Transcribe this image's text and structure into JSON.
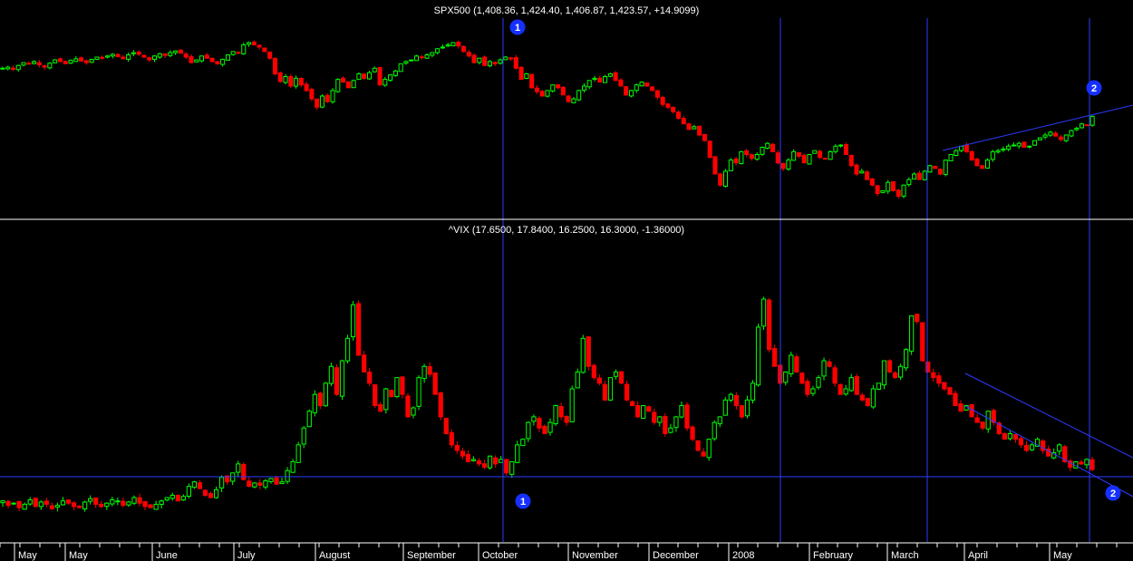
{
  "chart_data": [
    {
      "type": "candlestick",
      "title": "SPX500 (1,408.36, 1,424.40, 1,406.87, 1,423.57, +14.9099)",
      "ylim": [
        1250,
        1600
      ],
      "colors": {
        "up": "#00ff00",
        "down": "#ff0000"
      },
      "closes": [
        1510,
        1512,
        1508,
        1515,
        1520,
        1518,
        1522,
        1516,
        1512,
        1519,
        1525,
        1522,
        1518,
        1524,
        1527,
        1523,
        1520,
        1526,
        1530,
        1528,
        1532,
        1535,
        1531,
        1527,
        1534,
        1538,
        1535,
        1530,
        1525,
        1532,
        1536,
        1533,
        1538,
        1541,
        1537,
        1530,
        1520,
        1525,
        1532,
        1528,
        1522,
        1518,
        1526,
        1534,
        1540,
        1538,
        1552,
        1556,
        1552,
        1548,
        1540,
        1528,
        1500,
        1486,
        1495,
        1478,
        1492,
        1480,
        1470,
        1455,
        1440,
        1460,
        1450,
        1470,
        1490,
        1485,
        1475,
        1488,
        1500,
        1492,
        1502,
        1510,
        1480,
        1490,
        1498,
        1505,
        1518,
        1522,
        1525,
        1532,
        1530,
        1534,
        1538,
        1545,
        1548,
        1552,
        1556,
        1550,
        1540,
        1532,
        1520,
        1528,
        1515,
        1522,
        1518,
        1525,
        1530,
        1528,
        1510,
        1490,
        1500,
        1475,
        1468,
        1460,
        1470,
        1480,
        1475,
        1462,
        1450,
        1455,
        1470,
        1478,
        1488,
        1492,
        1485,
        1495,
        1500,
        1488,
        1478,
        1462,
        1470,
        1480,
        1485,
        1478,
        1470,
        1458,
        1445,
        1440,
        1432,
        1420,
        1410,
        1400,
        1405,
        1390,
        1380,
        1350,
        1320,
        1300,
        1325,
        1345,
        1340,
        1360,
        1355,
        1348,
        1355,
        1368,
        1375,
        1360,
        1340,
        1330,
        1345,
        1360,
        1352,
        1340,
        1355,
        1362,
        1350,
        1348,
        1360,
        1370,
        1372,
        1355,
        1335,
        1320,
        1325,
        1310,
        1300,
        1285,
        1290,
        1305,
        1290,
        1280,
        1300,
        1310,
        1320,
        1310,
        1325,
        1335,
        1330,
        1320,
        1345,
        1355,
        1362,
        1370,
        1360,
        1345,
        1335,
        1330,
        1345,
        1360,
        1362,
        1365,
        1370,
        1372,
        1375,
        1368,
        1370,
        1380,
        1385,
        1390,
        1395,
        1388,
        1382,
        1390,
        1398,
        1402,
        1410,
        1408,
        1423.57
      ]
    },
    {
      "type": "candlestick",
      "title": "^VIX (17.6500, 17.8400, 16.2500, 16.3000, -1.36000)",
      "ylim": [
        10,
        37
      ],
      "colors": {
        "up": "#00ff00",
        "down": "#ff0000"
      },
      "closes": [
        13.5,
        13.1,
        13.3,
        12.9,
        13.2,
        13.6,
        13.0,
        13.4,
        13.2,
        12.8,
        13.1,
        13.5,
        13.3,
        13.0,
        12.9,
        13.4,
        13.7,
        13.2,
        13.0,
        13.3,
        13.6,
        13.5,
        13.1,
        13.4,
        13.8,
        13.3,
        13.0,
        12.9,
        13.2,
        13.5,
        13.8,
        14.0,
        13.5,
        13.9,
        14.8,
        15.2,
        14.6,
        14.0,
        13.8,
        14.5,
        15.6,
        15.2,
        16.0,
        16.8,
        15.4,
        14.8,
        15.1,
        14.9,
        15.3,
        15.5,
        15.0,
        15.2,
        16.2,
        17.0,
        18.5,
        20.0,
        21.5,
        23.0,
        22.0,
        24.0,
        25.5,
        23.0,
        26.0,
        28.0,
        31.0,
        26.5,
        25.0,
        24.0,
        22.0,
        21.5,
        23.5,
        22.8,
        24.5,
        23.0,
        21.0,
        21.8,
        24.5,
        25.5,
        24.8,
        23.0,
        21.0,
        19.5,
        18.5,
        18.0,
        17.5,
        17.0,
        17.2,
        16.8,
        16.5,
        17.5,
        16.8,
        17.2,
        16.0,
        17.0,
        18.5,
        19.0,
        20.5,
        21.0,
        20.0,
        19.5,
        20.5,
        22.0,
        21.0,
        20.5,
        23.5,
        25.0,
        28.0,
        25.5,
        24.5,
        24.0,
        22.5,
        24.5,
        25.0,
        24.0,
        22.5,
        22.0,
        21.0,
        22.0,
        21.5,
        20.5,
        21.0,
        19.5,
        20.0,
        21.0,
        22.0,
        20.0,
        19.0,
        18.0,
        17.5,
        19.0,
        20.5,
        21.0,
        22.5,
        23.0,
        22.0,
        21.0,
        22.5,
        24.0,
        29.0,
        31.5,
        27.0,
        25.5,
        24.0,
        25.0,
        26.5,
        25.0,
        24.0,
        23.0,
        23.5,
        24.5,
        26.0,
        25.5,
        24.0,
        23.0,
        23.5,
        24.5,
        23.0,
        22.5,
        22.0,
        23.5,
        24.0,
        26.0,
        25.0,
        24.5,
        25.5,
        27.0,
        30.0,
        29.5,
        26.0,
        25.0,
        24.5,
        24.0,
        23.5,
        23.0,
        22.0,
        21.5,
        22.0,
        21.0,
        20.5,
        20.0,
        21.5,
        20.5,
        19.5,
        19.0,
        19.5,
        19.0,
        18.5,
        18.0,
        18.5,
        19.0,
        18.0,
        17.5,
        17.8,
        18.5,
        17.0,
        16.5,
        17.0,
        16.8,
        17.2,
        16.3
      ]
    }
  ],
  "x_axis_labels": [
    "May",
    "May",
    "June",
    "July",
    "August",
    "September",
    "October",
    "November",
    "December",
    "2008",
    "February",
    "March",
    "April",
    "May"
  ],
  "markers": {
    "one": "1",
    "two": "2"
  }
}
